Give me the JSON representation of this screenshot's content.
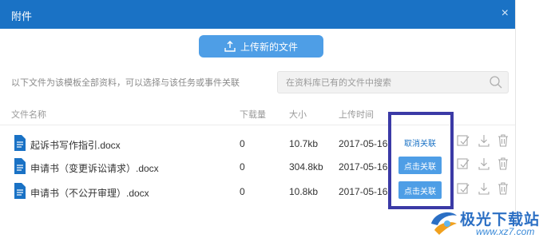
{
  "dialog": {
    "title": "附件",
    "close_symbol": "×"
  },
  "upload": {
    "label": "上传新的文件"
  },
  "hint": "以下文件为该模板全部资料，可以选择与该任务或事件关联",
  "search": {
    "placeholder": "在资料库已有的文件中搜索"
  },
  "columns": {
    "name": "文件名称",
    "downloads": "下载量",
    "size": "大小",
    "upload_time": "上传时间"
  },
  "files": [
    {
      "name": "起诉书写作指引.docx",
      "downloads": "0",
      "size": "10.7kb",
      "date": "2017-05-16",
      "action": "取消关联"
    },
    {
      "name": "申请书（变更诉讼请求）.docx",
      "downloads": "0",
      "size": "304.8kb",
      "date": "2017-05-16",
      "action": "点击关联"
    },
    {
      "name": "申请书（不公开审理）.docx",
      "downloads": "0",
      "size": "10.8kb",
      "date": "2017-05-16",
      "action": "点击关联"
    }
  ],
  "watermark": {
    "text": "极光下载站",
    "url": "www.xz7.com"
  },
  "colors": {
    "titlebar": "#1a72c5",
    "button": "#4e9ee6",
    "highlight": "#3b3aa6"
  }
}
